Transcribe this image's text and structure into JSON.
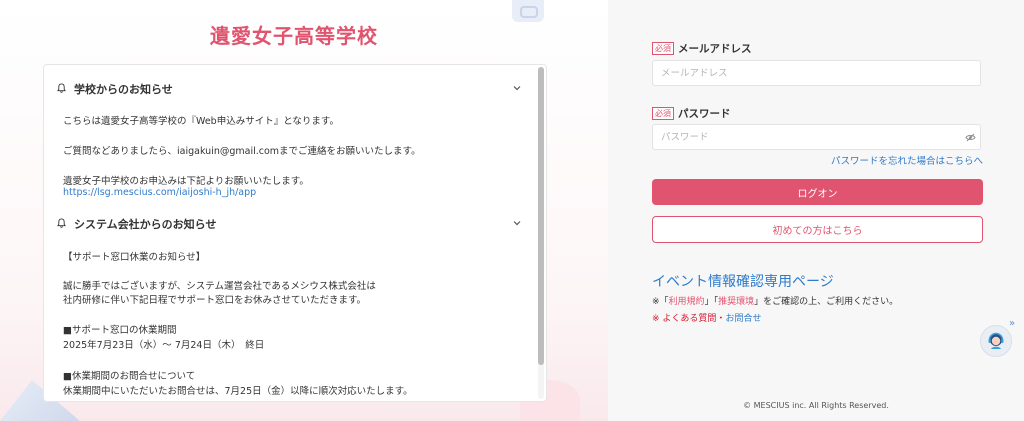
{
  "school": {
    "title": "遺愛女子高等学校"
  },
  "notices": [
    {
      "title": "学校からのお知らせ",
      "lines": [
        "こちらは遺愛女子高等学校の『Web申込みサイト』となります。",
        "ご質問などありましたら、iaigakuin@gmail.comまでご連絡をお願いいたします。",
        "遺愛女子中学校のお申込みは下記よりお願いいたします。"
      ],
      "link": "https://lsg.mescius.com/iaijoshi-h_jh/app"
    },
    {
      "title": "システム会社からのお知らせ",
      "lines": [
        "【サポート窓口休業のお知らせ】",
        "誠に勝手ではございますが、システム運営会社であるメシウス株式会社は",
        "社内研修に伴い下記日程でサポート窓口をお休みさせていただきます。",
        "■サポート窓口の休業期間",
        "2025年7月23日（水）～ 7月24日（木）　終日",
        "■休業期間のお問合せについて",
        "休業期間中にいただいたお問合せは、7月25日（金）以降に順次対応いたします。"
      ]
    }
  ],
  "login": {
    "required_badge": "必須",
    "email_label": "メールアドレス",
    "email_placeholder": "メールアドレス",
    "email_value": "",
    "password_label": "パスワード",
    "password_placeholder": "パスワード",
    "password_value": "",
    "forgot_link": "パスワードを忘れた場合はこちらへ",
    "login_button": "ログオン",
    "first_time_button": "初めての方はこちら"
  },
  "event": {
    "title": "イベント情報確認専用ページ",
    "note_prefix": "※「",
    "terms_link": "利用規約",
    "note_mid": "」「",
    "env_link": "推奨環境",
    "note_suffix": "」をご確認の上、ご利用ください。",
    "note2_prefix": "※ ",
    "faq_link": "よくある質問",
    "note2_sep": "・",
    "contact_link": "お問合せ"
  },
  "footer": {
    "copyright": "© MESCIUS inc. All Rights Reserved."
  },
  "colors": {
    "accent": "#e0546f",
    "link": "#2f7bcb"
  },
  "icons": [
    "bell-icon",
    "chevron-down-icon",
    "eye-slash-icon",
    "chat-support-icon",
    "double-chevron-right-icon"
  ]
}
